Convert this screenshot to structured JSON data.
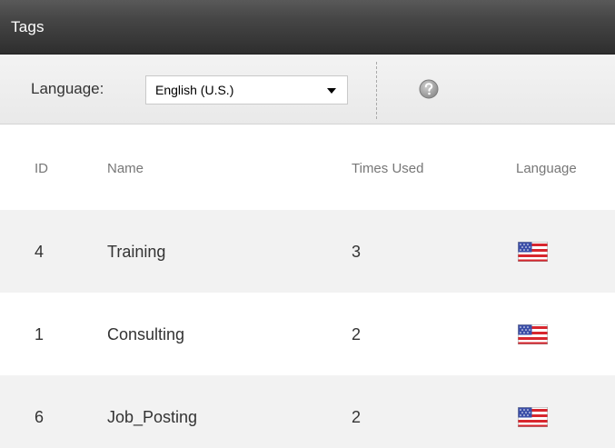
{
  "panel": {
    "title": "Tags"
  },
  "toolbar": {
    "language_label": "Language:",
    "language_selected": "English (U.S.)",
    "help_icon": "help-icon"
  },
  "table": {
    "columns": [
      "ID",
      "Name",
      "Times Used",
      "Language"
    ],
    "rows": [
      {
        "id": "4",
        "name": "Training",
        "times_used": "3",
        "language_icon": "us-flag-icon"
      },
      {
        "id": "1",
        "name": "Consulting",
        "times_used": "2",
        "language_icon": "us-flag-icon"
      },
      {
        "id": "6",
        "name": "Job_Posting",
        "times_used": "2",
        "language_icon": "us-flag-icon"
      }
    ]
  },
  "colors": {
    "title_bar": "#3a3a3a",
    "toolbar_bg": "#eeeeee",
    "row_alt_bg": "#f2f2f2",
    "header_text": "#777777",
    "cell_text": "#333333"
  }
}
